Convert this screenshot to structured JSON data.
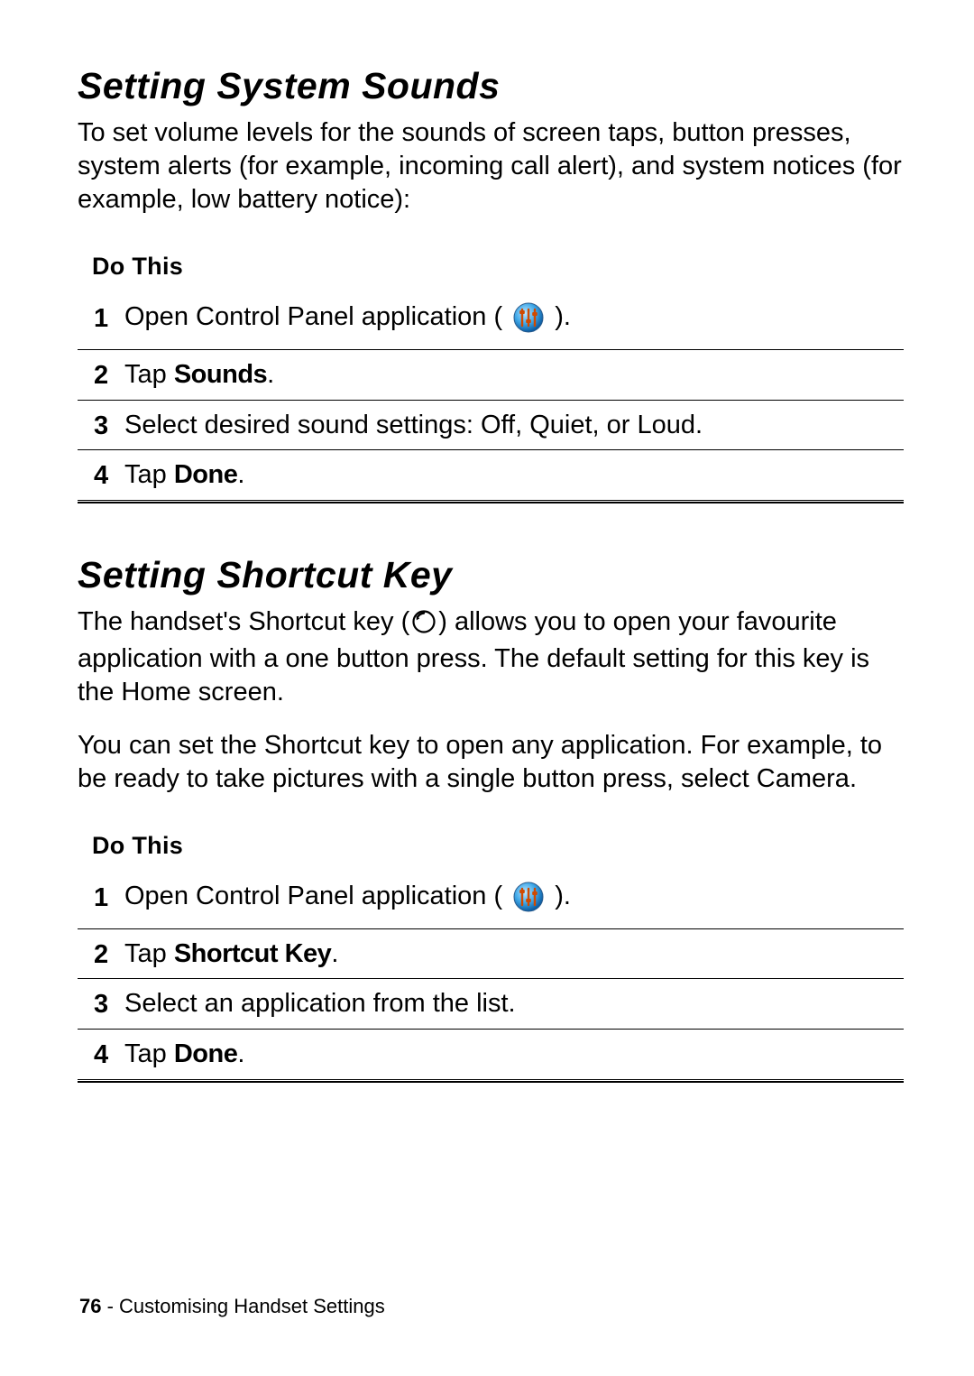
{
  "section1": {
    "title": "Setting System Sounds",
    "intro": "To set volume levels for the sounds of screen taps, button presses, system alerts (for example, incoming call alert), and system notices (for example, low battery notice):",
    "do_this": "Do This",
    "steps": [
      {
        "n": "1",
        "pre": "Open Control Panel application ( ",
        "kw": "",
        "post": " ).",
        "icon": "control-panel"
      },
      {
        "n": "2",
        "pre": "Tap ",
        "kw": "Sounds",
        "post": "."
      },
      {
        "n": "3",
        "pre": "Select desired sound settings: Off, Quiet, or Loud.",
        "kw": "",
        "post": ""
      },
      {
        "n": "4",
        "pre": "Tap ",
        "kw": "Done",
        "post": "."
      }
    ]
  },
  "section2": {
    "title": "Setting Shortcut Key",
    "intro1a": "The handset's Shortcut key (",
    "intro1b": ") allows you to open your favourite application with a one button press. The default setting for this key is the Home screen.",
    "intro2": "You can set the Shortcut key to open any application. For example, to be ready to take pictures with a single button press, select Camera.",
    "do_this": "Do This",
    "steps": [
      {
        "n": "1",
        "pre": "Open Control Panel application ( ",
        "kw": "",
        "post": " ).",
        "icon": "control-panel"
      },
      {
        "n": "2",
        "pre": "Tap ",
        "kw": "Shortcut Key",
        "post": "."
      },
      {
        "n": "3",
        "pre": "Select an application from the list.",
        "kw": "",
        "post": ""
      },
      {
        "n": "4",
        "pre": "Tap ",
        "kw": "Done",
        "post": "."
      }
    ]
  },
  "footer": {
    "page": "76",
    "sep": " - ",
    "chapter": "Customising Handset Settings"
  }
}
